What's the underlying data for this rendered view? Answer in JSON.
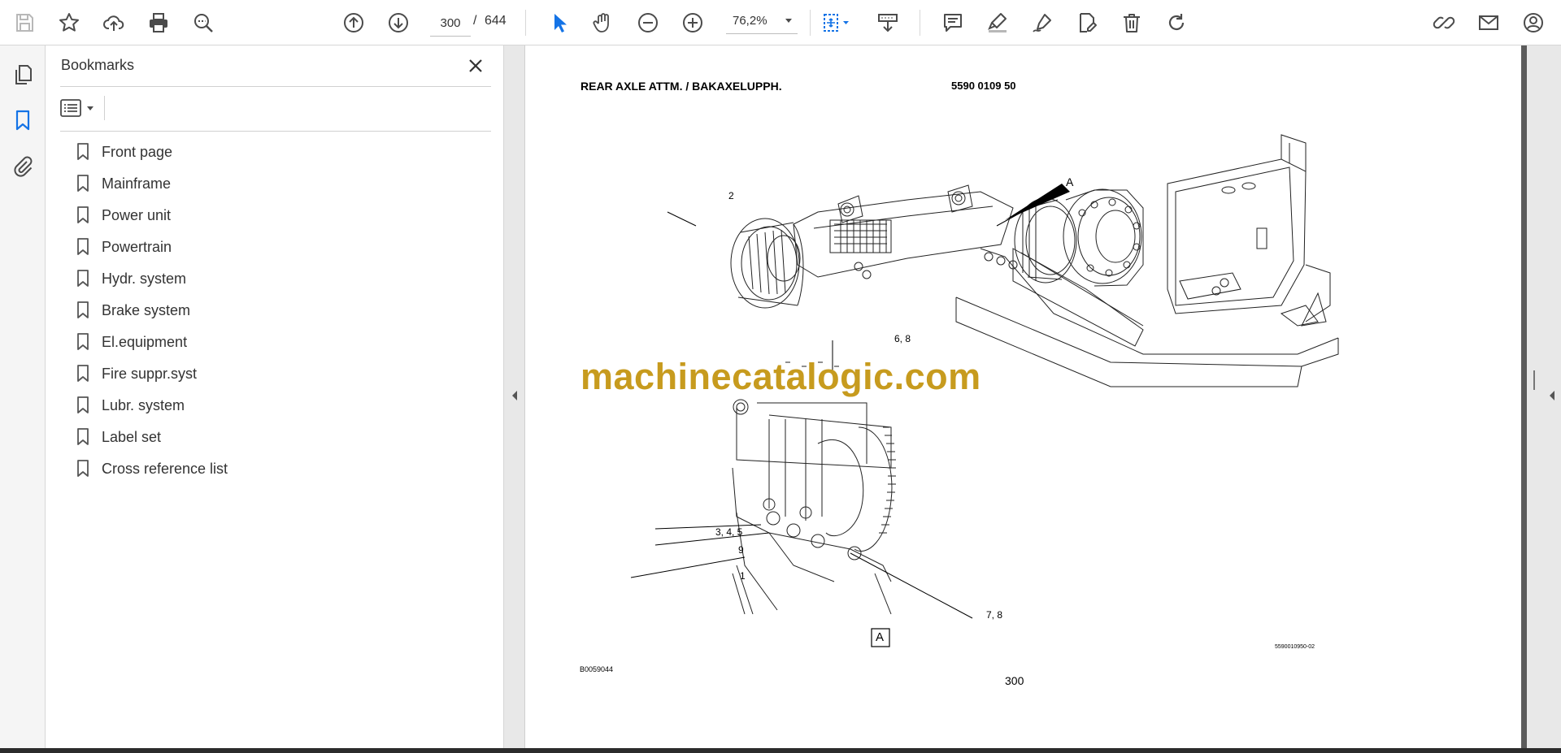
{
  "toolbar": {
    "page_current": "300",
    "page_separator": "/",
    "page_total": "644",
    "zoom": "76,2%"
  },
  "bookmarks_panel": {
    "title": "Bookmarks",
    "items": [
      {
        "label": "Front page"
      },
      {
        "label": "Mainframe"
      },
      {
        "label": "Power unit"
      },
      {
        "label": "Powertrain"
      },
      {
        "label": "Hydr. system"
      },
      {
        "label": "Brake system"
      },
      {
        "label": "El.equipment"
      },
      {
        "label": "Fire suppr.syst"
      },
      {
        "label": "Lubr. system"
      },
      {
        "label": "Label set"
      },
      {
        "label": "Cross reference list"
      }
    ]
  },
  "document": {
    "heading": "REAR AXLE ATTM. / BAKAXELUPPH.",
    "part_number": "5590 0109 50",
    "watermark": "machinecatalogic.com",
    "callouts": {
      "c2": "2",
      "cA": "A",
      "c68": "6, 8",
      "c345": "3, 4, 5",
      "c9": "9",
      "c1": "1",
      "c78": "7, 8",
      "detail": "A"
    },
    "drawing_ref": "B0059044",
    "file_ref": "5590010950-02",
    "page_number": "300"
  },
  "colors": {
    "accent_blue": "#1473e6",
    "watermark": "#c79b1e",
    "icon_gray": "#4b4b4b",
    "panel_bg": "#f5f5f5"
  }
}
